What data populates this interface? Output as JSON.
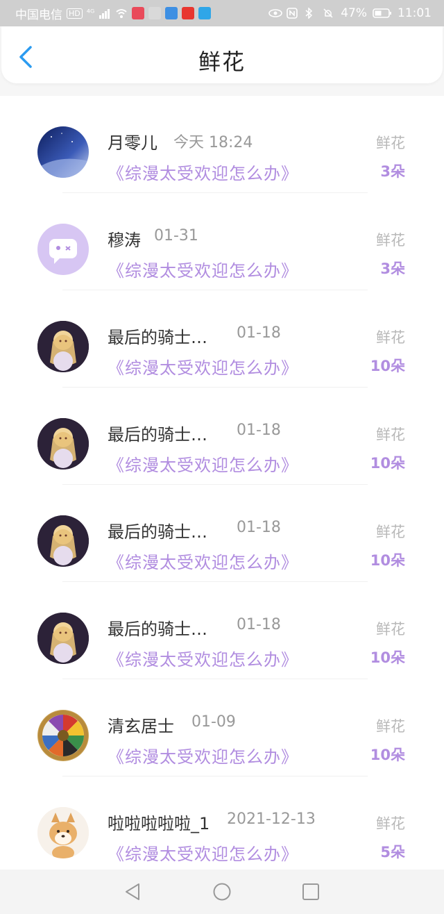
{
  "status_bar": {
    "carrier": "中国电信",
    "hd": "HD",
    "signal": "⁴ᴳ",
    "battery": "47%",
    "time": "11:01"
  },
  "header": {
    "title": "鲜花",
    "back_icon": "chevron-left-icon"
  },
  "list": {
    "items": [
      {
        "name": "月零儿",
        "date": "今天 18:24",
        "book": "《综漫太受欢迎怎么办》",
        "kind": "鲜花",
        "count": "3朵",
        "avatar": "starry-sky"
      },
      {
        "name": "穆涛",
        "date": "01-31",
        "book": "《综漫太受欢迎怎么办》",
        "kind": "鲜花",
        "count": "3朵",
        "avatar": "default-chat"
      },
      {
        "name": "最后的骑士…",
        "date": "01-18",
        "book": "《综漫太受欢迎怎么办》",
        "kind": "鲜花",
        "count": "10朵",
        "avatar": "anime-girl"
      },
      {
        "name": "最后的骑士…",
        "date": "01-18",
        "book": "《综漫太受欢迎怎么办》",
        "kind": "鲜花",
        "count": "10朵",
        "avatar": "anime-girl"
      },
      {
        "name": "最后的骑士…",
        "date": "01-18",
        "book": "《综漫太受欢迎怎么办》",
        "kind": "鲜花",
        "count": "10朵",
        "avatar": "anime-girl"
      },
      {
        "name": "最后的骑士…",
        "date": "01-18",
        "book": "《综漫太受欢迎怎么办》",
        "kind": "鲜花",
        "count": "10朵",
        "avatar": "anime-girl"
      },
      {
        "name": "清玄居士",
        "date": "01-09",
        "book": "《综漫太受欢迎怎么办》",
        "kind": "鲜花",
        "count": "10朵",
        "avatar": "bagua-wheel"
      },
      {
        "name": "啦啦啦啦啦_1",
        "date": "2021-12-13",
        "book": "《综漫太受欢迎怎么办》",
        "kind": "鲜花",
        "count": "5朵",
        "avatar": "shiba-dog"
      }
    ]
  },
  "nav_bar": {
    "back": "triangle-back-icon",
    "home": "circle-home-icon",
    "recents": "square-recents-icon"
  },
  "colors": {
    "accent_purple": "#b18de0",
    "back_blue": "#2b9bf0"
  }
}
